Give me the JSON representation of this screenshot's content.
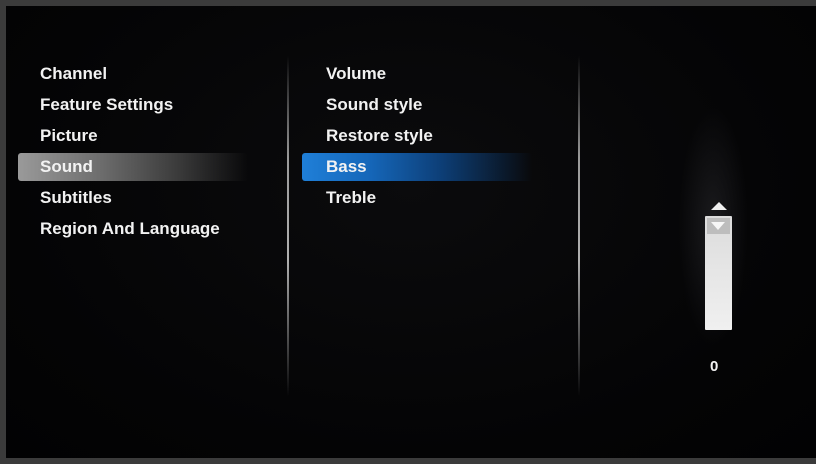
{
  "menu": {
    "items": [
      {
        "label": "Channel"
      },
      {
        "label": "Feature Settings"
      },
      {
        "label": "Picture"
      },
      {
        "label": "Sound"
      },
      {
        "label": "Subtitles"
      },
      {
        "label": "Region And Language"
      }
    ]
  },
  "submenu": {
    "items": [
      {
        "label": "Volume"
      },
      {
        "label": "Sound style"
      },
      {
        "label": "Restore style"
      },
      {
        "label": "Bass"
      },
      {
        "label": "Treble"
      }
    ]
  },
  "slider": {
    "value": "0",
    "up_icon": "triangle-up-icon",
    "down_icon": "triangle-down-icon"
  },
  "colors": {
    "focus": "#1f7fd8",
    "parent_highlight": "#8a8a8a",
    "text": "#f2f2f2",
    "background": "#040405"
  }
}
